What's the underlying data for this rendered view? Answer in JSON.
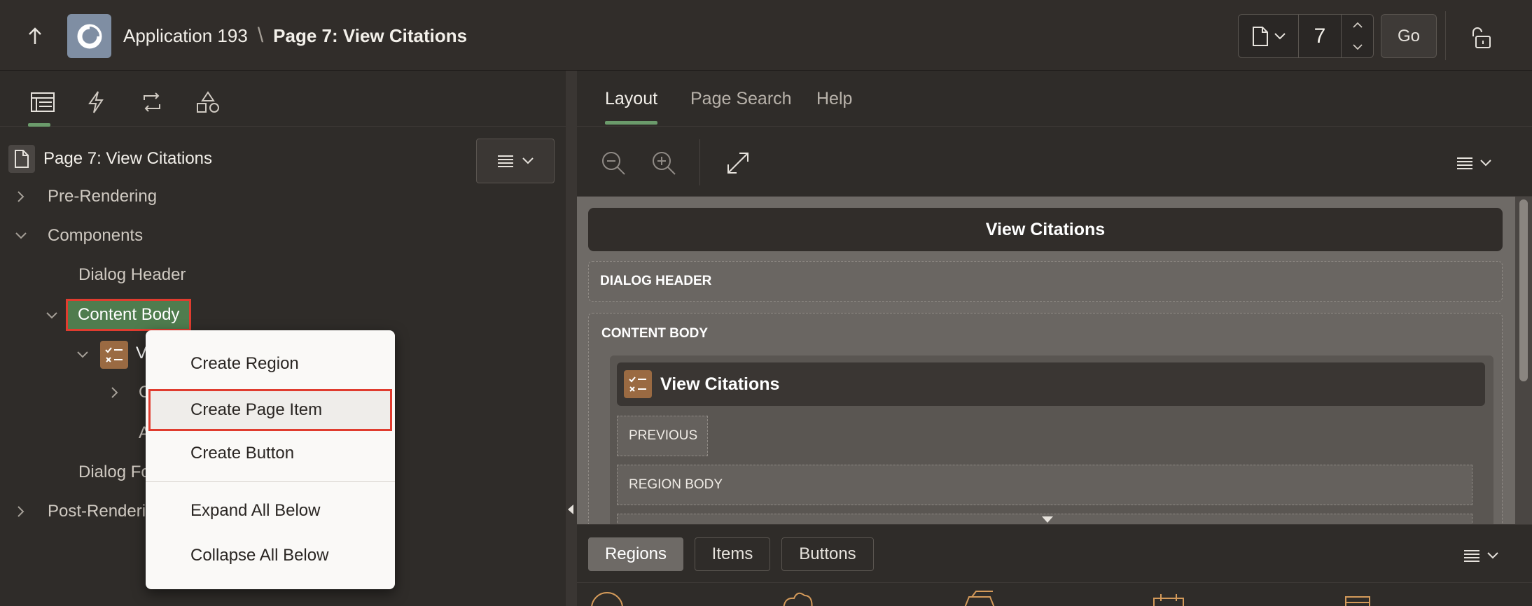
{
  "header": {
    "app_name": "Application 193",
    "separator": "\\",
    "page_name": "Page 7: View Citations",
    "page_number": "7",
    "go_label": "Go",
    "icons": {
      "up": "arrow-up-icon",
      "app": "app-logo-icon",
      "page_type": "page-icon",
      "lock": "unlock-icon"
    }
  },
  "left": {
    "tabs": [
      {
        "name": "rendering-tab",
        "icon": "rendering-tree-icon",
        "active": true
      },
      {
        "name": "dynamic-actions-tab",
        "icon": "lightning-icon",
        "active": false
      },
      {
        "name": "processing-tab",
        "icon": "processing-loop-icon",
        "active": false
      },
      {
        "name": "shared-components-tab",
        "icon": "shapes-icon",
        "active": false
      }
    ],
    "tree": {
      "root": "Page 7: View Citations",
      "pre_rendering": "Pre-Rendering",
      "components": "Components",
      "dialog_header": "Dialog Header",
      "content_body": "Content Body",
      "region_partial": "V",
      "child_partial": "C",
      "child2_partial": "A",
      "dialog_footer_partial": "Dialog Fo",
      "post_rendering_partial": "Post-Renderi"
    }
  },
  "context_menu": {
    "items": [
      {
        "label": "Create Region",
        "highlighted": false
      },
      {
        "label": "Create Page Item",
        "highlighted": true
      },
      {
        "label": "Create Button",
        "highlighted": false
      },
      {
        "label": "Expand All Below",
        "highlighted": false
      },
      {
        "label": "Collapse All Below",
        "highlighted": false
      }
    ]
  },
  "right": {
    "tabs": [
      {
        "label": "Layout",
        "active": true
      },
      {
        "label": "Page Search",
        "active": false
      },
      {
        "label": "Help",
        "active": false
      }
    ],
    "layout": {
      "title": "View Citations",
      "dialog_header": "DIALOG HEADER",
      "content_body": "CONTENT BODY",
      "region_title": "View Citations",
      "previous": "PREVIOUS",
      "region_body": "REGION BODY"
    },
    "gallery_tabs": [
      {
        "label": "Regions",
        "active": true
      },
      {
        "label": "Items",
        "active": false
      },
      {
        "label": "Buttons",
        "active": false
      }
    ]
  },
  "colors": {
    "accent_green": "#4f7c4e",
    "highlight_red": "#e03c2f",
    "region_icon": "#9a6a42"
  }
}
